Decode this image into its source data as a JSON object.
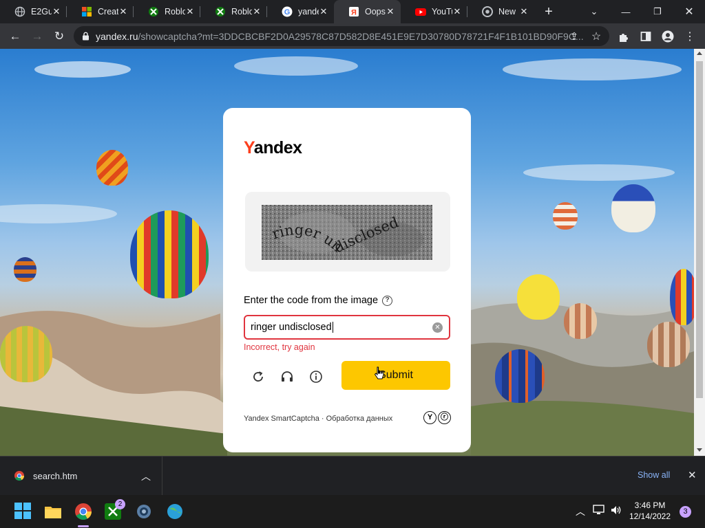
{
  "browser": {
    "tabs": [
      {
        "title": "E2Gu",
        "icon": "globe-icon"
      },
      {
        "title": "Creat",
        "icon": "microsoft-icon"
      },
      {
        "title": "Roblo",
        "icon": "xbox-icon"
      },
      {
        "title": "Roblo",
        "icon": "xbox-icon"
      },
      {
        "title": "yande",
        "icon": "google-icon"
      },
      {
        "title": "Oops",
        "icon": "yandex-icon"
      },
      {
        "title": "YouTu",
        "icon": "youtube-icon"
      },
      {
        "title": "New",
        "icon": "chrome-icon"
      }
    ],
    "active_tab": 5,
    "new_tab": "+",
    "url_host": "yandex.ru",
    "url_path": "/showcaptcha?mt=3DDCBCBF2D0A29578C87D582D8E451E9E7D30780D78721F4F1B101BD90F9C..."
  },
  "captcha": {
    "logo_first": "Y",
    "logo_rest": "andex",
    "captcha_text": "ringer undisclosed",
    "prompt": "Enter the code from the image",
    "help_glyph": "?",
    "input_value": "ringer undisclosed",
    "error": "Incorrect, try again",
    "submit_label": "Submit",
    "footer": "Yandex SmartCaptcha · Обработка данных",
    "accent": "#fdc700",
    "error_color": "#e0343e"
  },
  "downloads": {
    "file": "search.htm",
    "show_all": "Show all"
  },
  "taskbar": {
    "time": "3:46 PM",
    "date": "12/14/2022",
    "notif_count": "3",
    "xbox_badge": "2"
  }
}
